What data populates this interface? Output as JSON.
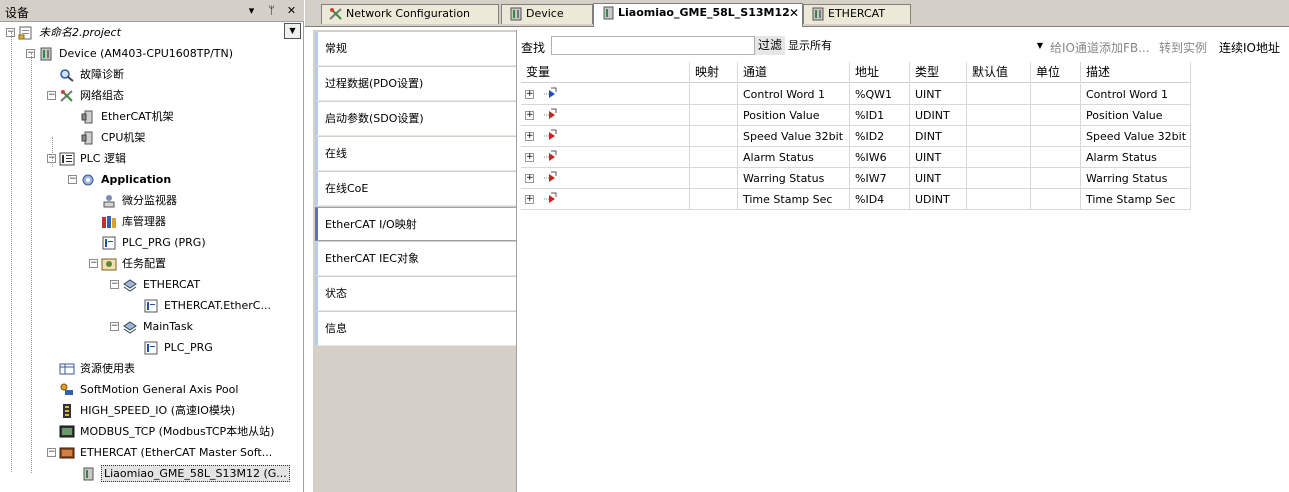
{
  "left_panel": {
    "title": "设备",
    "pin_glyph": "▾",
    "dock_glyph": "ᛘ",
    "close_glyph": "✕",
    "tree": [
      {
        "label": "未命名2.project",
        "icon": "project-icon",
        "style": "italic"
      },
      {
        "label": "Device (AM403-CPU1608TP/TN)",
        "icon": "device-icon"
      },
      {
        "label": "故障诊断",
        "icon": "diagnosis-icon"
      },
      {
        "label": "网络组态",
        "icon": "network-config-icon"
      },
      {
        "label": "EtherCAT机架",
        "icon": "rack-icon"
      },
      {
        "label": "CPU机架",
        "icon": "rack-icon"
      },
      {
        "label": "PLC 逻辑",
        "icon": "plc-logic-icon"
      },
      {
        "label": "Application",
        "icon": "application-icon",
        "style": "bold"
      },
      {
        "label": "微分监视器",
        "icon": "monitor-icon"
      },
      {
        "label": "库管理器",
        "icon": "library-icon"
      },
      {
        "label": "PLC_PRG (PRG)",
        "icon": "program-icon"
      },
      {
        "label": "任务配置",
        "icon": "task-config-icon"
      },
      {
        "label": "ETHERCAT",
        "icon": "task-icon"
      },
      {
        "label": "ETHERCAT.EtherC...",
        "icon": "program-icon"
      },
      {
        "label": "MainTask",
        "icon": "task-icon"
      },
      {
        "label": "PLC_PRG",
        "icon": "program-icon"
      },
      {
        "label": "资源使用表",
        "icon": "table-icon"
      },
      {
        "label": "SoftMotion General Axis Pool",
        "icon": "axis-icon"
      },
      {
        "label": "HIGH_SPEED_IO (高速IO模块)",
        "icon": "io-module-icon"
      },
      {
        "label": "MODBUS_TCP (ModbusTCP本地从站)",
        "icon": "modbus-icon"
      },
      {
        "label": "ETHERCAT (EtherCAT Master Soft...",
        "icon": "ethercat-master-icon"
      },
      {
        "label": "Liaomiao_GME_58L_S13M12 (G...",
        "icon": "slave-device-icon",
        "selected": true
      }
    ]
  },
  "tabs": [
    {
      "label": "Network Configuration",
      "icon": "network-config-icon"
    },
    {
      "label": "Device",
      "icon": "device-icon"
    },
    {
      "label": "Liaomiao_GME_58L_S13M12",
      "icon": "slave-device-icon",
      "active": true,
      "close": "✕"
    },
    {
      "label": "ETHERCAT",
      "icon": "device-icon"
    }
  ],
  "settings_tabs": [
    {
      "label": "常规"
    },
    {
      "label": "过程数据(PDO设置)"
    },
    {
      "label": "启动参数(SDO设置)"
    },
    {
      "label": "在线"
    },
    {
      "label": "在线CoE"
    },
    {
      "label": "EtherCAT I/O映射",
      "active": true
    },
    {
      "label": "EtherCAT IEC对象"
    },
    {
      "label": "状态"
    },
    {
      "label": "信息"
    }
  ],
  "toolbar": {
    "find_label": "查找",
    "find_value": "",
    "filter_label": "过滤",
    "filter_value": "显示所有",
    "add_fb_label": "给IO通道添加FB...",
    "goto_instance_label": "转到实例",
    "continuous_io_label": "连续IO地址"
  },
  "grid": {
    "columns": [
      "变量",
      "映射",
      "通道",
      "地址",
      "类型",
      "默认值",
      "单位",
      "描述"
    ],
    "rows": [
      {
        "variable": "",
        "mapping": "",
        "channel": "Control Word 1",
        "address": "%QW1",
        "type": "UINT",
        "default": "",
        "unit": "",
        "description": "Control Word 1",
        "direction": "output"
      },
      {
        "variable": "",
        "mapping": "",
        "channel": "Position Value",
        "address": "%ID1",
        "type": "UDINT",
        "default": "",
        "unit": "",
        "description": "Position Value",
        "direction": "input"
      },
      {
        "variable": "",
        "mapping": "",
        "channel": "Speed Value 32bit",
        "address": "%ID2",
        "type": "DINT",
        "default": "",
        "unit": "",
        "description": "Speed Value 32bit",
        "direction": "input"
      },
      {
        "variable": "",
        "mapping": "",
        "channel": "Alarm Status",
        "address": "%IW6",
        "type": "UINT",
        "default": "",
        "unit": "",
        "description": "Alarm Status",
        "direction": "input"
      },
      {
        "variable": "",
        "mapping": "",
        "channel": "Warring Status",
        "address": "%IW7",
        "type": "UINT",
        "default": "",
        "unit": "",
        "description": "Warring Status",
        "direction": "input"
      },
      {
        "variable": "",
        "mapping": "",
        "channel": "Time Stamp Sec",
        "address": "%ID4",
        "type": "UDINT",
        "default": "",
        "unit": "",
        "description": "Time Stamp Sec",
        "direction": "input"
      }
    ],
    "expand_glyph": "+"
  },
  "colors": {
    "chrome": "#d4d0c8",
    "active_tab_accent": "#4b79c4",
    "io_input": "#d02020",
    "io_output": "#2050c0"
  }
}
